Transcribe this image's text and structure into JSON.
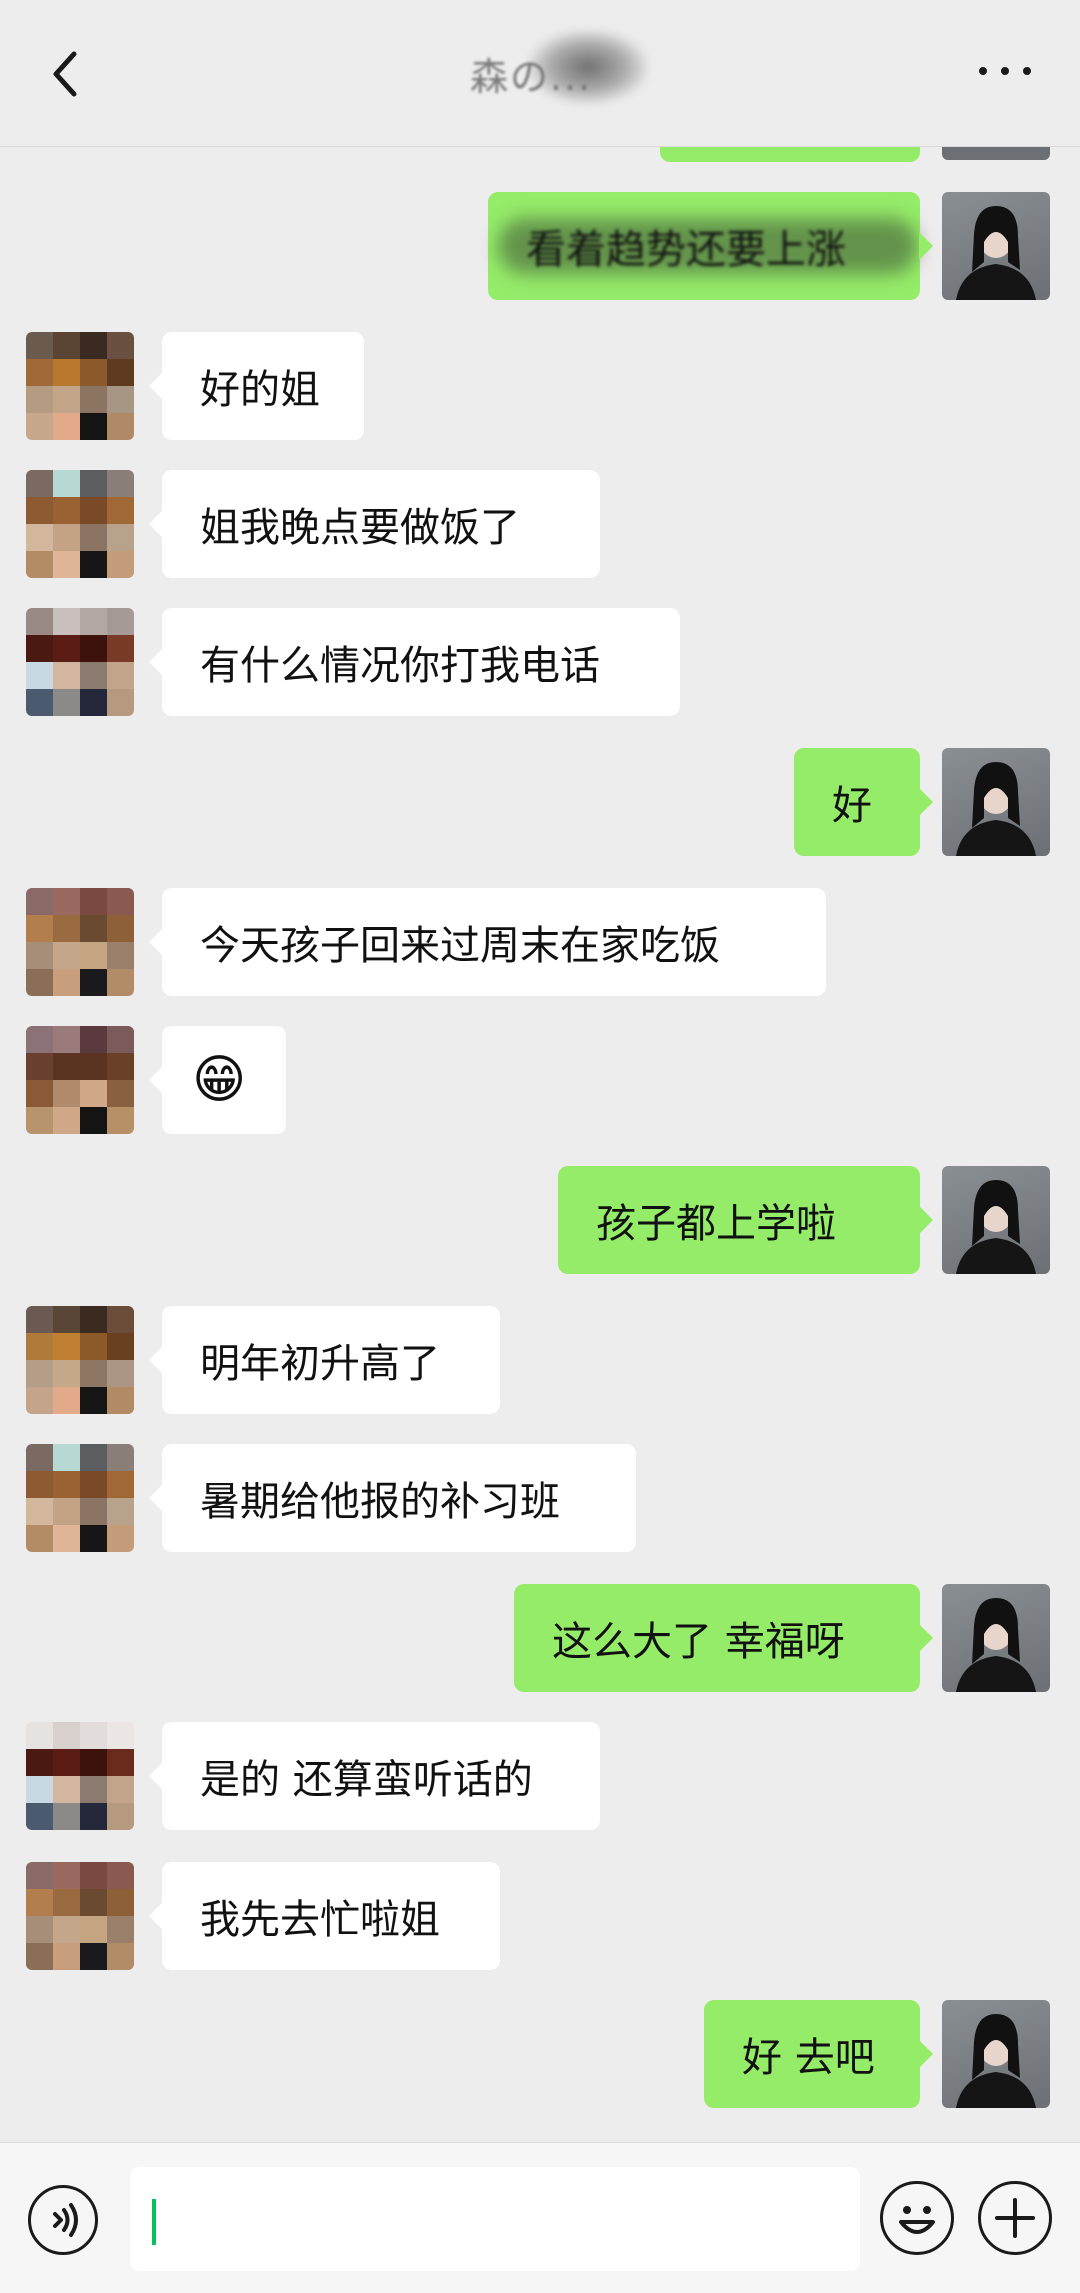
{
  "header": {
    "title": "森の...",
    "back_icon": "chevron-left-icon",
    "more_icon": "more-dots-icon"
  },
  "messages": [
    {
      "from": "me",
      "text": "看着趋势还要上涨"
    },
    {
      "from": "contact",
      "text": "好的姐"
    },
    {
      "from": "contact",
      "text": "姐我晚点要做饭了"
    },
    {
      "from": "contact",
      "text": "有什么情况你打我电话"
    },
    {
      "from": "me",
      "text": "好"
    },
    {
      "from": "contact",
      "text": "今天孩子回来过周末在家吃饭"
    },
    {
      "from": "contact",
      "text": "😁"
    },
    {
      "from": "me",
      "text": "孩子都上学啦"
    },
    {
      "from": "contact",
      "text": "明年初升高了"
    },
    {
      "from": "contact",
      "text": "暑期给他报的补习班"
    },
    {
      "from": "me",
      "text": "这么大了 幸福呀"
    },
    {
      "from": "contact",
      "text": "是的 还算蛮听话的"
    },
    {
      "from": "contact",
      "text": "我先去忙啦姐"
    },
    {
      "from": "me",
      "text": "好 去吧"
    }
  ],
  "input_bar": {
    "voice_icon": "voice-icon",
    "text_value": "",
    "emoji_icon": "emoji-icon",
    "plus_icon": "plus-icon"
  },
  "colors": {
    "background": "#ededed",
    "outgoing_bubble": "#95ec69",
    "incoming_bubble": "#ffffff",
    "caret": "#07c160"
  }
}
